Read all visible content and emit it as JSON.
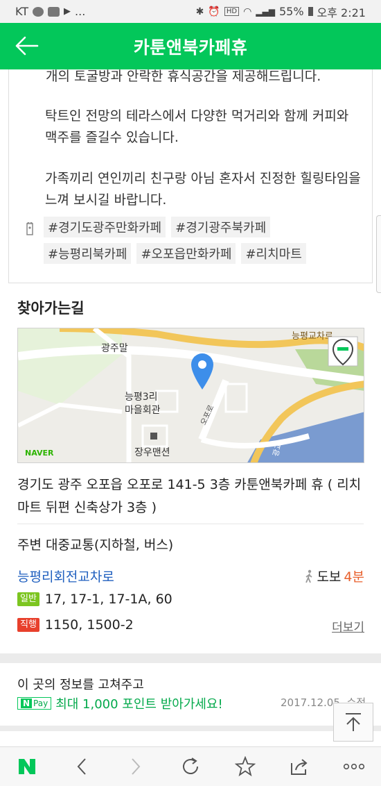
{
  "status_bar": {
    "carrier": "KT",
    "battery": "55%",
    "time": "오후 2:21",
    "dots": "..."
  },
  "app_bar": {
    "title": "카툰앤북카페휴"
  },
  "description": {
    "lines": [
      "개의 토굴방과 안락한 휴식공간을 제공해드립니다.",
      "탁트인 전망의 테라스에서 다양한 먹거리와 함께  커피와 맥주를 즐길수 있습니다.",
      "가족끼리 연인끼리 친구랑 아님 혼자서 진정한 힐링타임을 느껴 보시길 바랍니다."
    ]
  },
  "tags": [
    "#경기도광주만화카페",
    "#경기광주북카페",
    "#능평리북카페",
    "#오포읍만화카페",
    "#리치마트"
  ],
  "directions": {
    "heading": "찾아가는길",
    "map": {
      "labels": {
        "road_top": "능평교차로",
        "village": "광주말",
        "hall_1": "능평3리",
        "hall_2": "마을회관",
        "restaurant": "장우맨션",
        "road_mid": "오포로",
        "road_right": "광교"
      },
      "logo": "NAVER"
    },
    "address": "경기도 광주 오포읍 오포로 141-5 3층 카툰앤북카페 휴 ( 리치마트 뒤편 신축상가 3층 )"
  },
  "transit": {
    "heading": "주변 대중교통(지하철, 버스)",
    "station": "능평리회전교차로",
    "walk_label": "도보",
    "walk_time": "4분",
    "buses": [
      {
        "badge": "일반",
        "color": "#7cc520",
        "routes": "17,  17-1,  17-1A,  60"
      },
      {
        "badge": "직행",
        "color": "#e8402c",
        "routes": "1150,  1500-2"
      }
    ],
    "more": "더보기"
  },
  "edit": {
    "heading": "이 곳의 정보를 고쳐주고",
    "npay_badge_n": "N",
    "npay_badge_text": "Pay",
    "promo": "최대 1,000 포인트 받아가세요!",
    "date": "2017.12.05. 수정"
  },
  "colors": {
    "brand": "#03c75a",
    "link": "#1f5fbf",
    "walk": "#e8602c"
  }
}
